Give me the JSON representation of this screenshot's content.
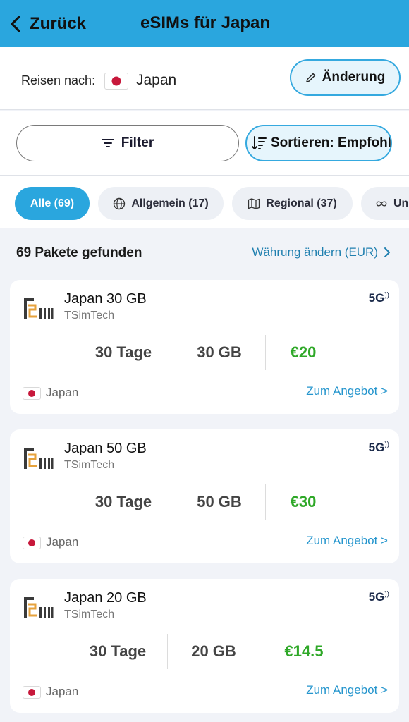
{
  "header": {
    "back_label": "Zurück",
    "title": "eSIMs für Japan"
  },
  "destination": {
    "label": "Reisen nach:",
    "country": "Japan",
    "change_label": "Änderung"
  },
  "toolbar": {
    "filter_label": "Filter",
    "sort_label": "Sortieren: Empfohlen"
  },
  "chips": [
    {
      "label": "Alle (69)",
      "active": true,
      "icon": ""
    },
    {
      "label": "Allgemein (17)",
      "active": false,
      "icon": "globe-icon"
    },
    {
      "label": "Regional (37)",
      "active": false,
      "icon": "map-icon"
    },
    {
      "label": "Un",
      "active": false,
      "icon": "infinity-icon"
    }
  ],
  "results": {
    "count_text": "69 Pakete gefunden",
    "currency_link": "Währung ändern (EUR)"
  },
  "plans": [
    {
      "name": "Japan 30 GB",
      "provider": "TSimTech",
      "network": "5G",
      "duration": "30 Tage",
      "data": "30 GB",
      "price": "€20",
      "country": "Japan",
      "offer_label": "Zum Angebot >"
    },
    {
      "name": "Japan 50 GB",
      "provider": "TSimTech",
      "network": "5G",
      "duration": "30 Tage",
      "data": "50 GB",
      "price": "€30",
      "country": "Japan",
      "offer_label": "Zum Angebot >"
    },
    {
      "name": "Japan 20 GB",
      "provider": "TSimTech",
      "network": "5G",
      "duration": "30 Tage",
      "data": "20 GB",
      "price": "€14.5",
      "country": "Japan",
      "offer_label": "Zum Angebot >"
    }
  ],
  "colors": {
    "brand": "#2aa6de",
    "price": "#2fa828",
    "link": "#2495cd"
  }
}
